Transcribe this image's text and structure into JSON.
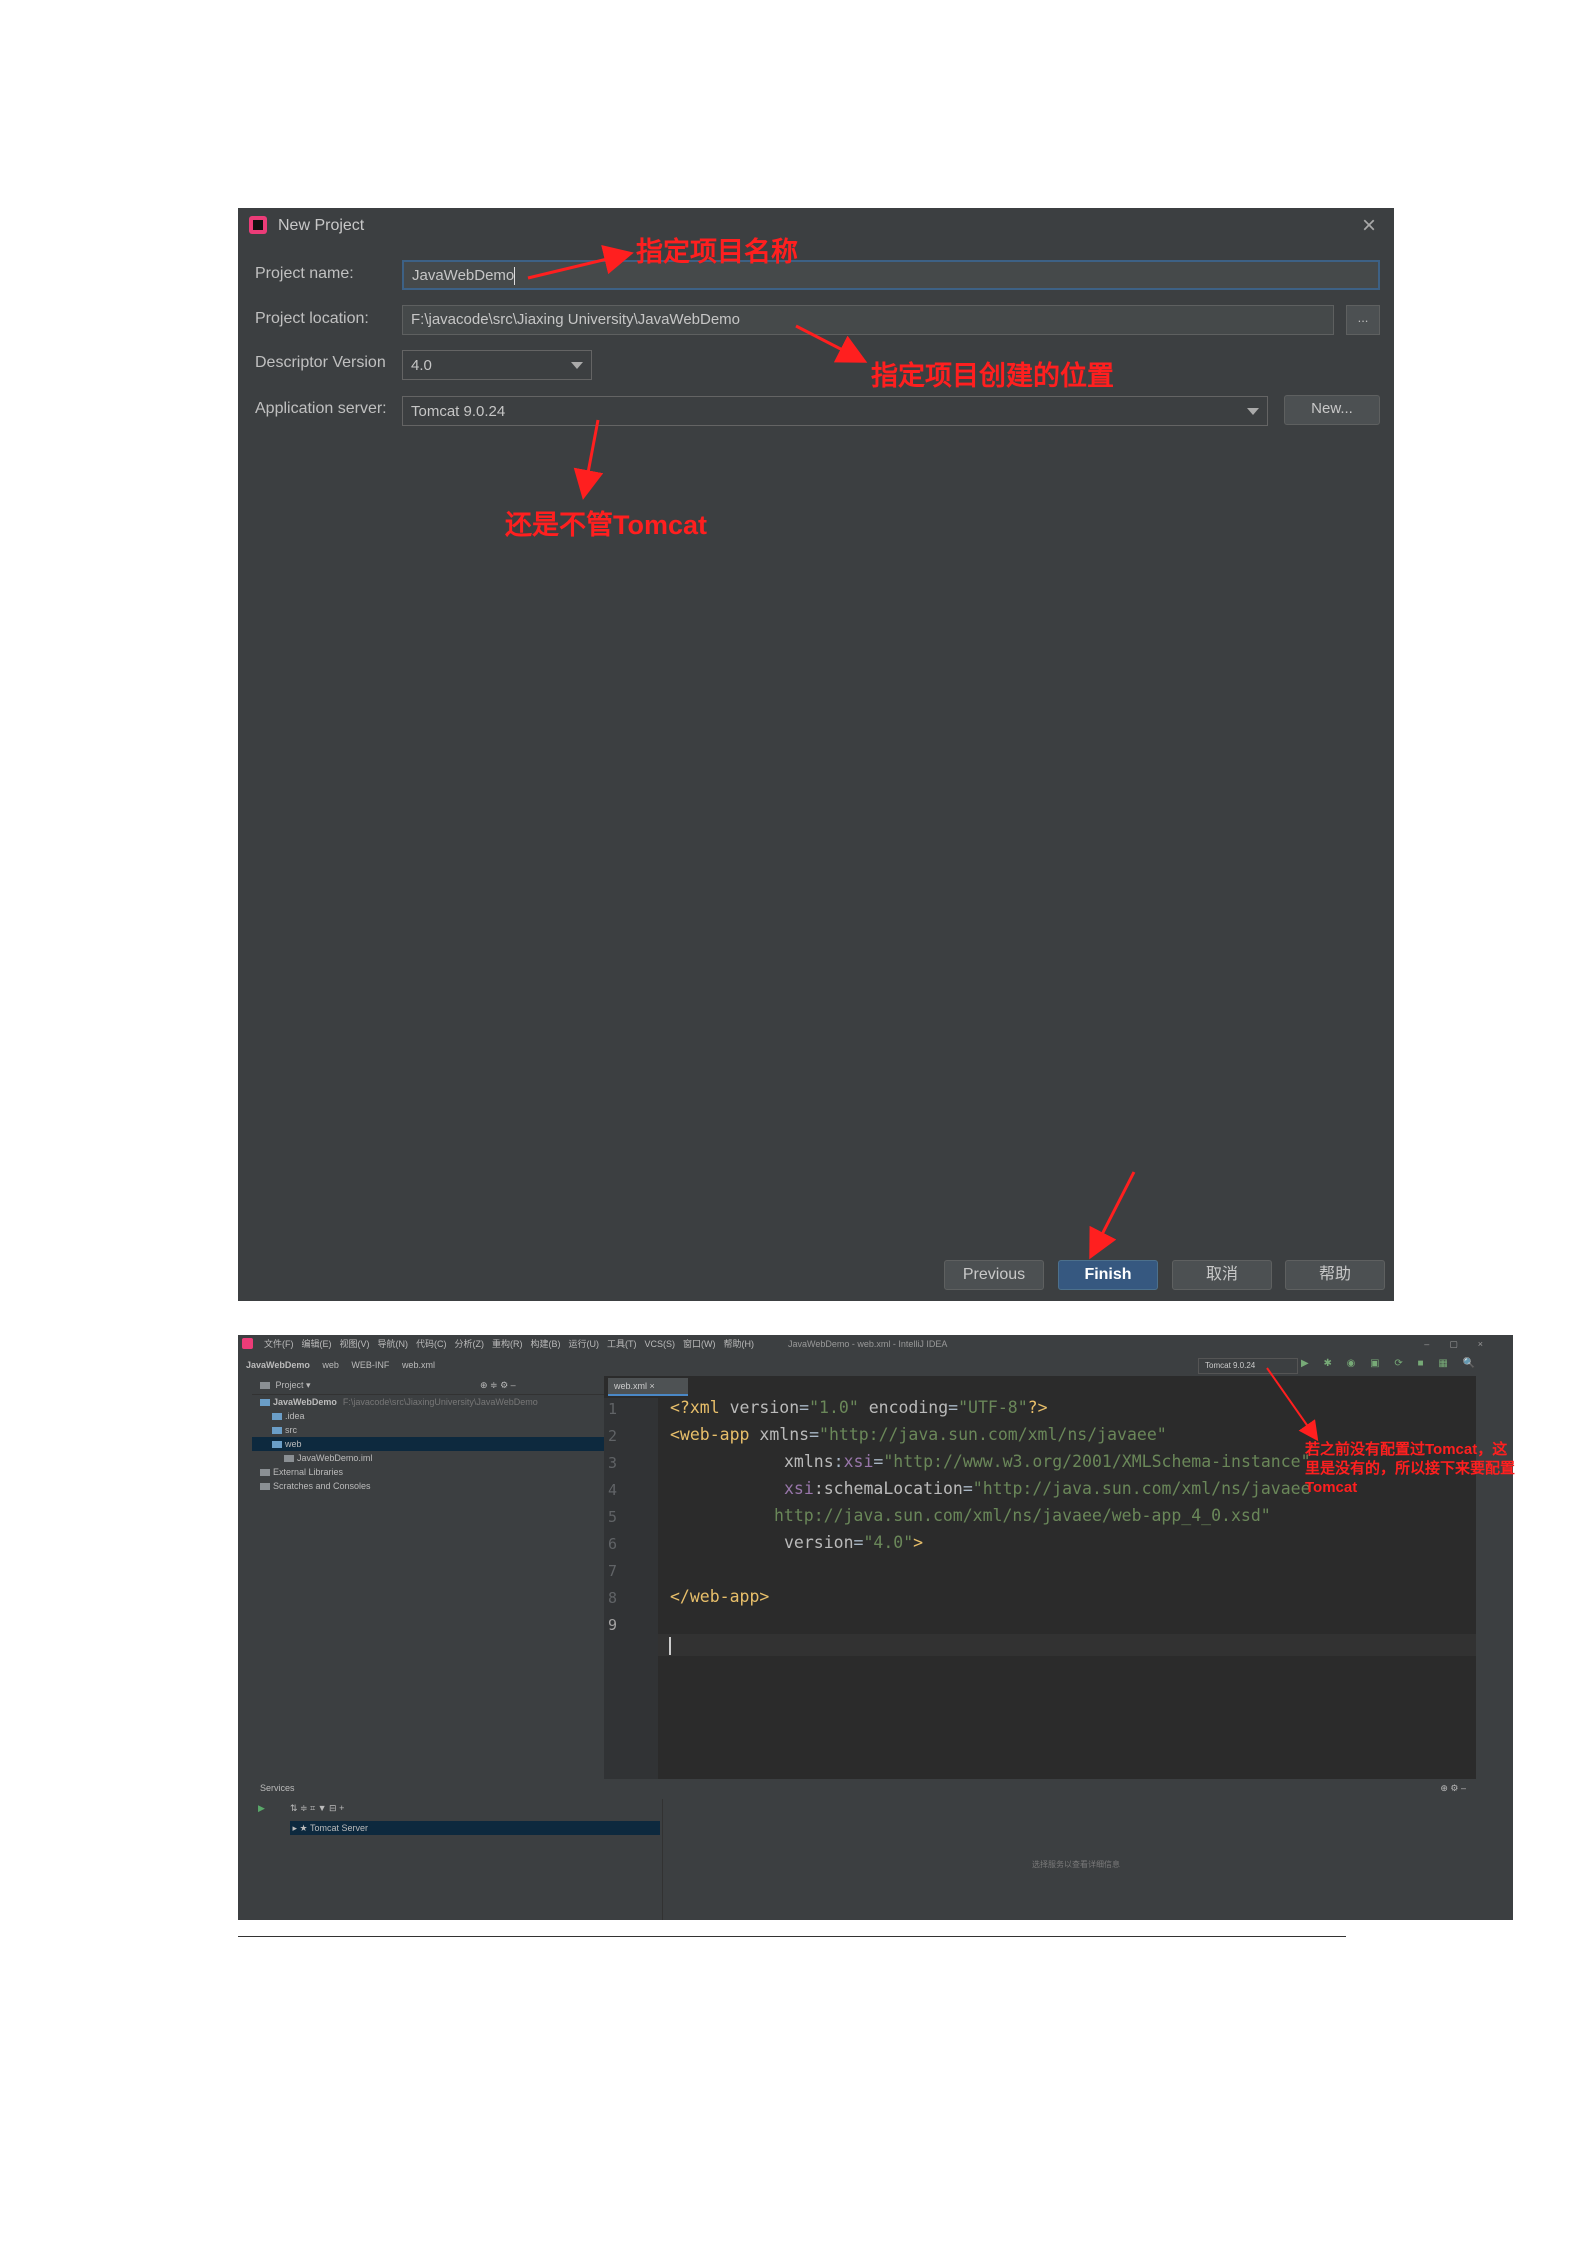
{
  "dialog": {
    "title": "New Project",
    "close_icon": "close-icon",
    "labels": {
      "project_name": "Project name:",
      "project_location": "Project location:",
      "descriptor_version": "Descriptor Version",
      "application_server": "Application server:"
    },
    "values": {
      "project_name": "JavaWebDemo",
      "project_location": "F:\\javacode\\src\\Jiaxing University\\JavaWebDemo",
      "descriptor_version": "4.0",
      "application_server": "Tomcat 9.0.24"
    },
    "browse_label": "...",
    "new_label": "New...",
    "buttons": {
      "previous": "Previous",
      "finish": "Finish",
      "cancel": "取消",
      "help": "帮助"
    }
  },
  "annotations": {
    "name": "指定项目名称",
    "location": "指定项目创建的位置",
    "server": "还是不管Tomcat",
    "ide": "若之前没有配置过Tomcat，这里是没有的，所以接下来要配置Tomcat"
  },
  "ide": {
    "menu": [
      "文件(F)",
      "编辑(E)",
      "视图(V)",
      "导航(N)",
      "代码(C)",
      "分析(Z)",
      "重构(R)",
      "构建(B)",
      "运行(U)",
      "工具(T)",
      "VCS(S)",
      "窗口(W)",
      "帮助(H)"
    ],
    "window_title": "JavaWebDemo - web.xml - IntelliJ IDEA",
    "breadcrumbs": [
      "JavaWebDemo",
      "web",
      "WEB-INF",
      "web.xml"
    ],
    "run_config": "Tomcat 9.0.24",
    "project_header": "Project",
    "tree": [
      {
        "label": "JavaWebDemo",
        "hint": "F:\\javacode\\src\\JiaxingUniversity\\JavaWebDemo",
        "indent": 0
      },
      {
        "label": ".idea",
        "indent": 1
      },
      {
        "label": "src",
        "indent": 1
      },
      {
        "label": "web",
        "indent": 1
      },
      {
        "label": "JavaWebDemo.iml",
        "indent": 2
      },
      {
        "label": "External Libraries",
        "indent": 0
      },
      {
        "label": "Scratches and Consoles",
        "indent": 0
      }
    ],
    "editor_tab": "web.xml",
    "line_numbers": [
      "1",
      "2",
      "3",
      "4",
      "5",
      "6",
      "7",
      "8",
      "9"
    ],
    "code": {
      "l1": [
        "<?xml ",
        "version",
        "=",
        "\"1.0\"",
        " encoding",
        "=",
        "\"UTF-8\"",
        "?>"
      ],
      "l2": [
        "<web-app ",
        "xmlns",
        "=",
        "\"http://java.sun.com/xml/ns/javaee\""
      ],
      "l3": [
        "xmlns",
        ":",
        "xsi",
        "=",
        "\"http://www.w3.org/2001/XMLSchema-instance\""
      ],
      "l4": [
        "xsi",
        ":schemaLocation",
        "=",
        "\"http://java.sun.com/xml/ns/javaee"
      ],
      "l5": "http://java.sun.com/xml/ns/javaee/web-app_4_0.xsd\"",
      "l6": [
        "version",
        "=",
        "\"4.0\"",
        ">"
      ],
      "l8": "</web-app>"
    },
    "services_header": "Services",
    "service_item": "Tomcat Server",
    "services_hint": "选择服务以查看详细信息"
  }
}
